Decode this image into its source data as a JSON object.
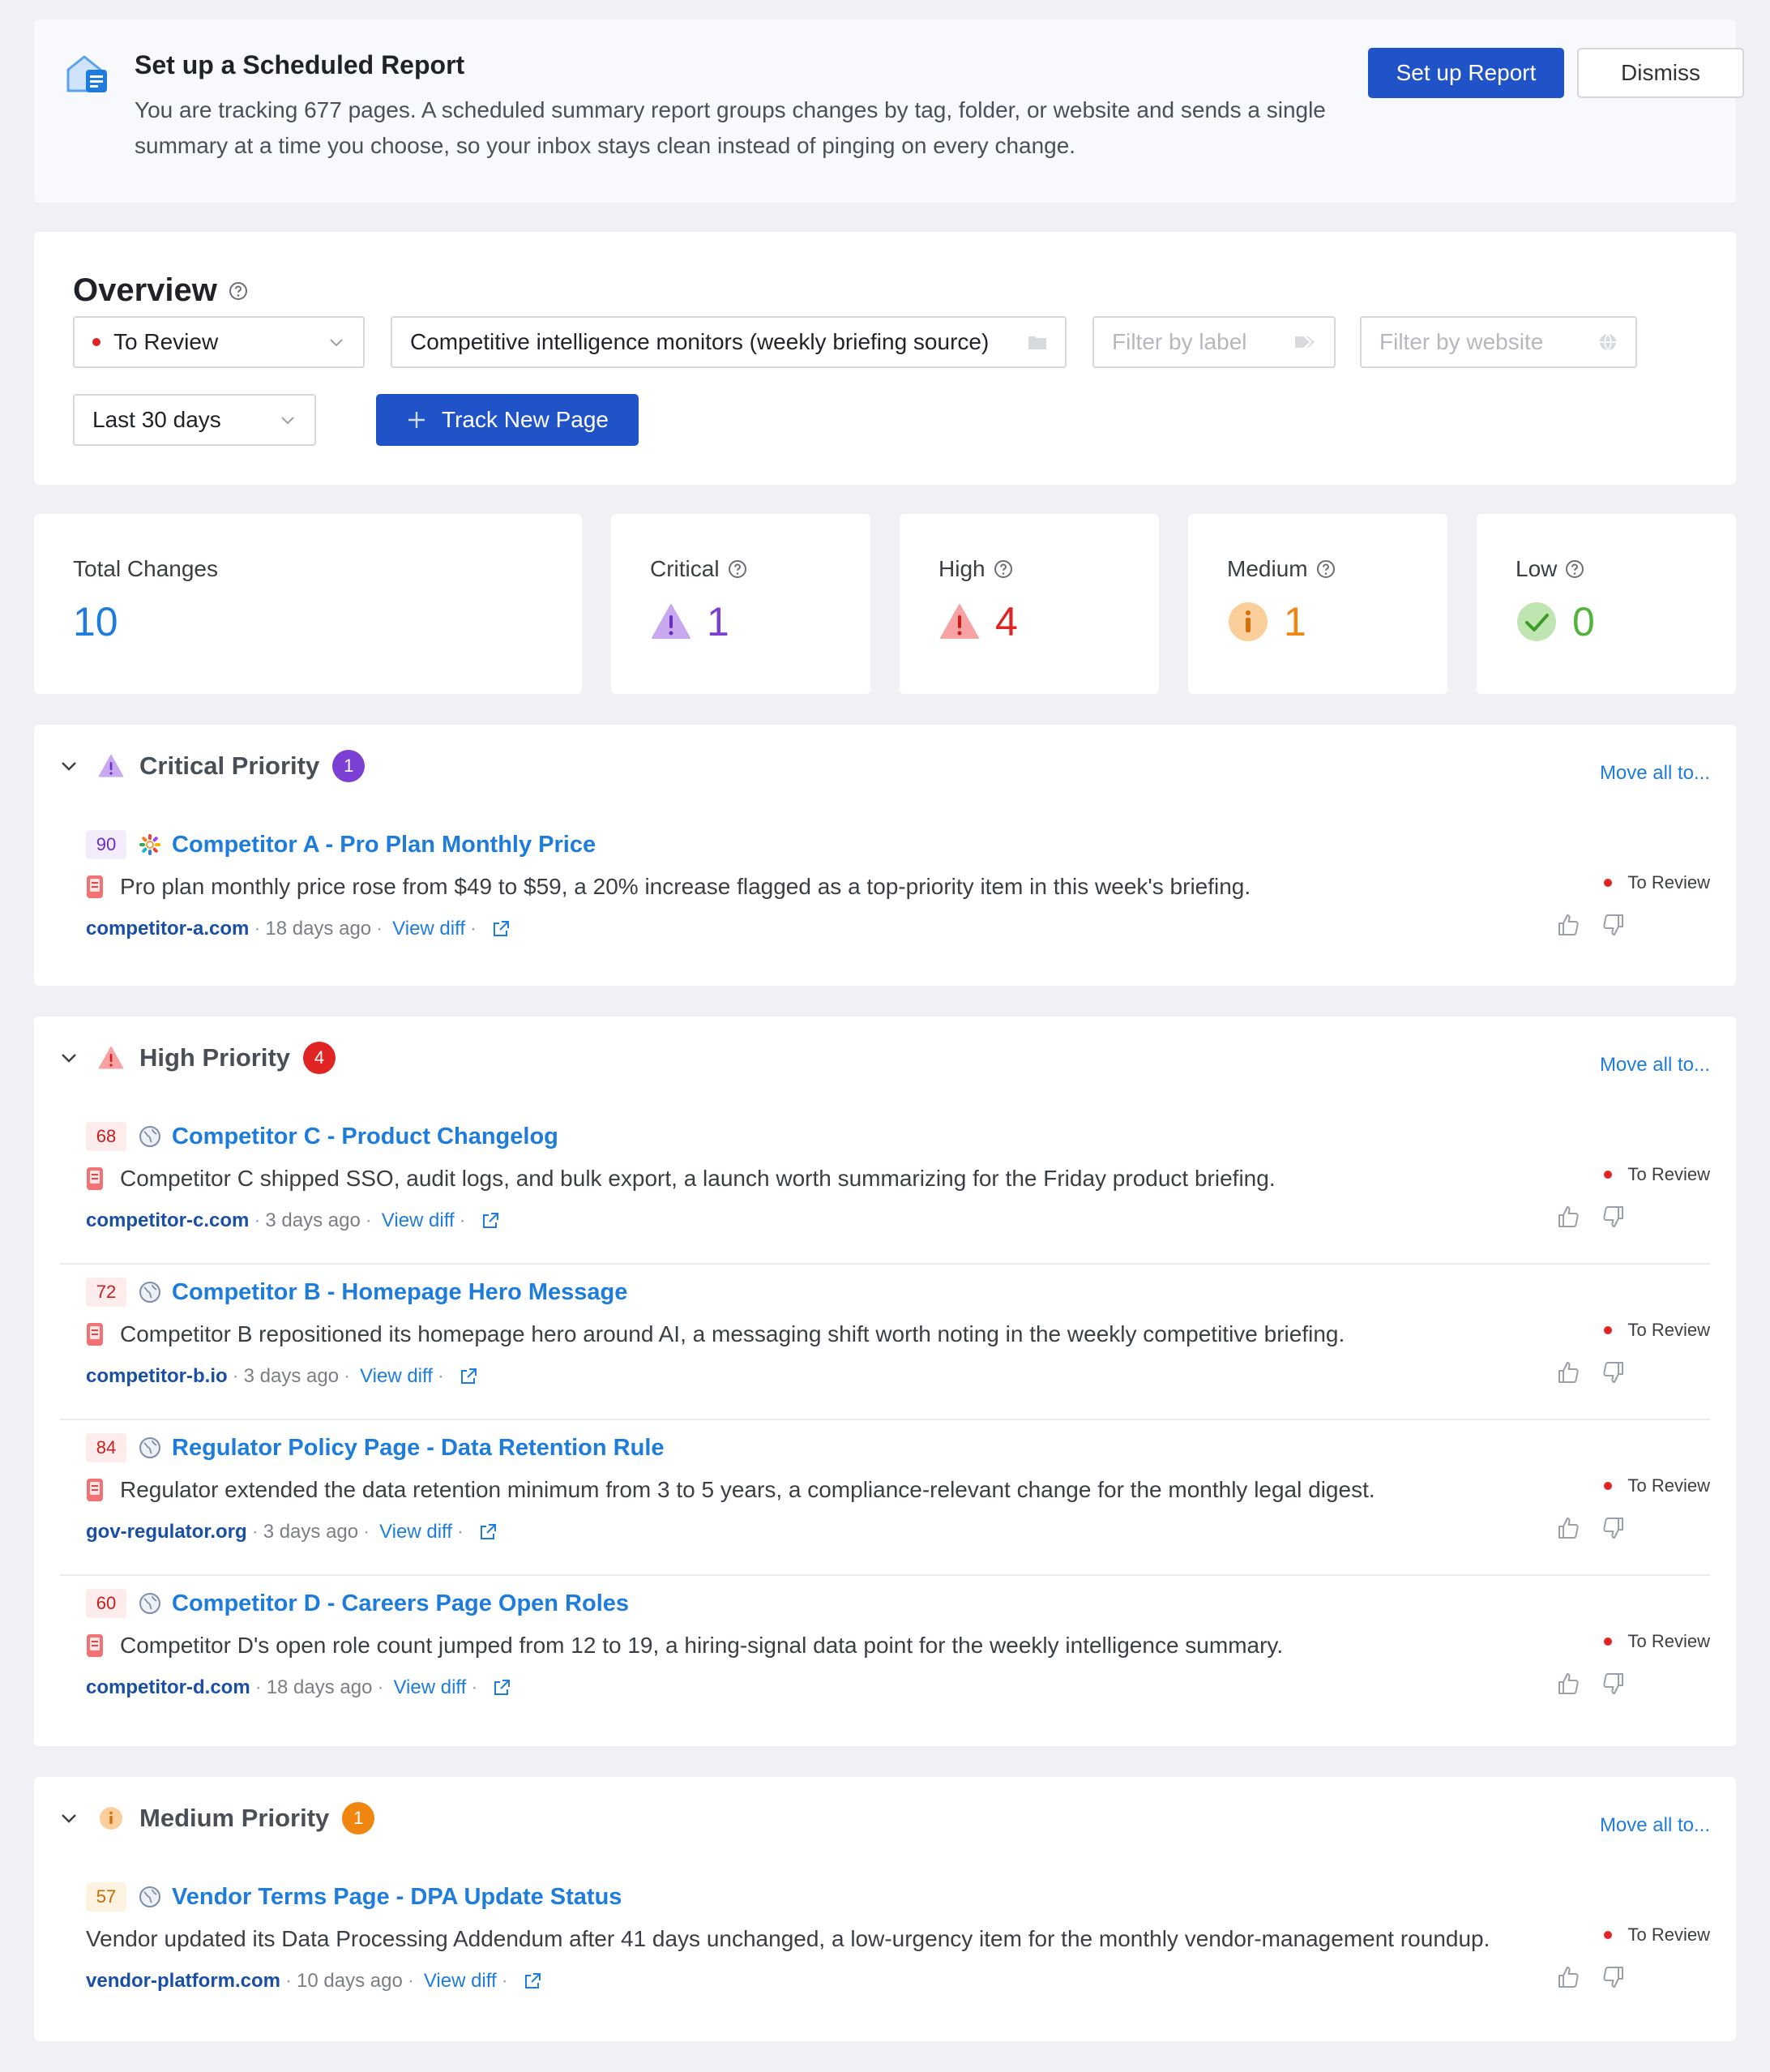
{
  "banner": {
    "title": "Set up a Scheduled Report",
    "description": "You are tracking 677 pages. A scheduled summary report groups changes by tag, folder, or website and sends a single summary at a time you choose, so your inbox stays clean instead of pinging on every change.",
    "setup_label": "Set up Report",
    "dismiss_label": "Dismiss",
    "icon": "report-house-icon"
  },
  "overview": {
    "title": "Overview",
    "status_filter": "To Review",
    "folder_filter": "Competitive intelligence monitors (weekly briefing source)",
    "label_placeholder": "Filter by label",
    "website_placeholder": "Filter by website",
    "date_range": "Last 30 days",
    "track_label": "Track New Page"
  },
  "stats": {
    "total": {
      "label": "Total Changes",
      "value": "10"
    },
    "critical": {
      "label": "Critical",
      "value": "1"
    },
    "high": {
      "label": "High",
      "value": "4"
    },
    "medium": {
      "label": "Medium",
      "value": "1"
    },
    "low": {
      "label": "Low",
      "value": "0"
    }
  },
  "colors": {
    "critical": "#7b3fd4",
    "high": "#e02424",
    "medium": "#f0850f",
    "low": "#52b43c",
    "total": "#1e7ddc",
    "link": "#1e7ddc",
    "primary_button": "#2153c8"
  },
  "sections": {
    "critical": {
      "title": "Critical Priority",
      "count": "1",
      "move_all": "Move all to...",
      "items": [
        {
          "score": "90",
          "title": "Competitor A - Pro Plan Monthly Price",
          "description": "Pro plan monthly price rose from $49 to $59, a 20% increase flagged as a top-priority item in this week's briefing.",
          "domain": "competitor-a.com",
          "ago": "18 days ago",
          "diff": "View diff",
          "status": "To Review",
          "site_icon": "colorful-flower-icon"
        }
      ]
    },
    "high": {
      "title": "High Priority",
      "count": "4",
      "move_all": "Move all to...",
      "items": [
        {
          "score": "68",
          "title": "Competitor C - Product Changelog",
          "description": "Competitor C shipped SSO, audit logs, and bulk export, a launch worth summarizing for the Friday product briefing.",
          "domain": "competitor-c.com",
          "ago": "3 days ago",
          "diff": "View diff",
          "status": "To Review",
          "site_icon": "globe-icon"
        },
        {
          "score": "72",
          "title": "Competitor B - Homepage Hero Message",
          "description": "Competitor B repositioned its homepage hero around AI, a messaging shift worth noting in the weekly competitive briefing.",
          "domain": "competitor-b.io",
          "ago": "3 days ago",
          "diff": "View diff",
          "status": "To Review",
          "site_icon": "globe-icon"
        },
        {
          "score": "84",
          "title": "Regulator Policy Page - Data Retention Rule",
          "description": "Regulator extended the data retention minimum from 3 to 5 years, a compliance-relevant change for the monthly legal digest.",
          "domain": "gov-regulator.org",
          "ago": "3 days ago",
          "diff": "View diff",
          "status": "To Review",
          "site_icon": "globe-icon"
        },
        {
          "score": "60",
          "title": "Competitor D - Careers Page Open Roles",
          "description": "Competitor D's open role count jumped from 12 to 19, a hiring-signal data point for the weekly intelligence summary.",
          "domain": "competitor-d.com",
          "ago": "18 days ago",
          "diff": "View diff",
          "status": "To Review",
          "site_icon": "globe-icon"
        }
      ]
    },
    "medium": {
      "title": "Medium Priority",
      "count": "1",
      "move_all": "Move all to...",
      "items": [
        {
          "score": "57",
          "title": "Vendor Terms Page - DPA Update Status",
          "description": "Vendor updated its Data Processing Addendum after 41 days unchanged, a low-urgency item for the monthly vendor-management roundup.",
          "domain": "vendor-platform.com",
          "ago": "10 days ago",
          "diff": "View diff",
          "status": "To Review",
          "site_icon": "globe-icon"
        }
      ]
    }
  }
}
